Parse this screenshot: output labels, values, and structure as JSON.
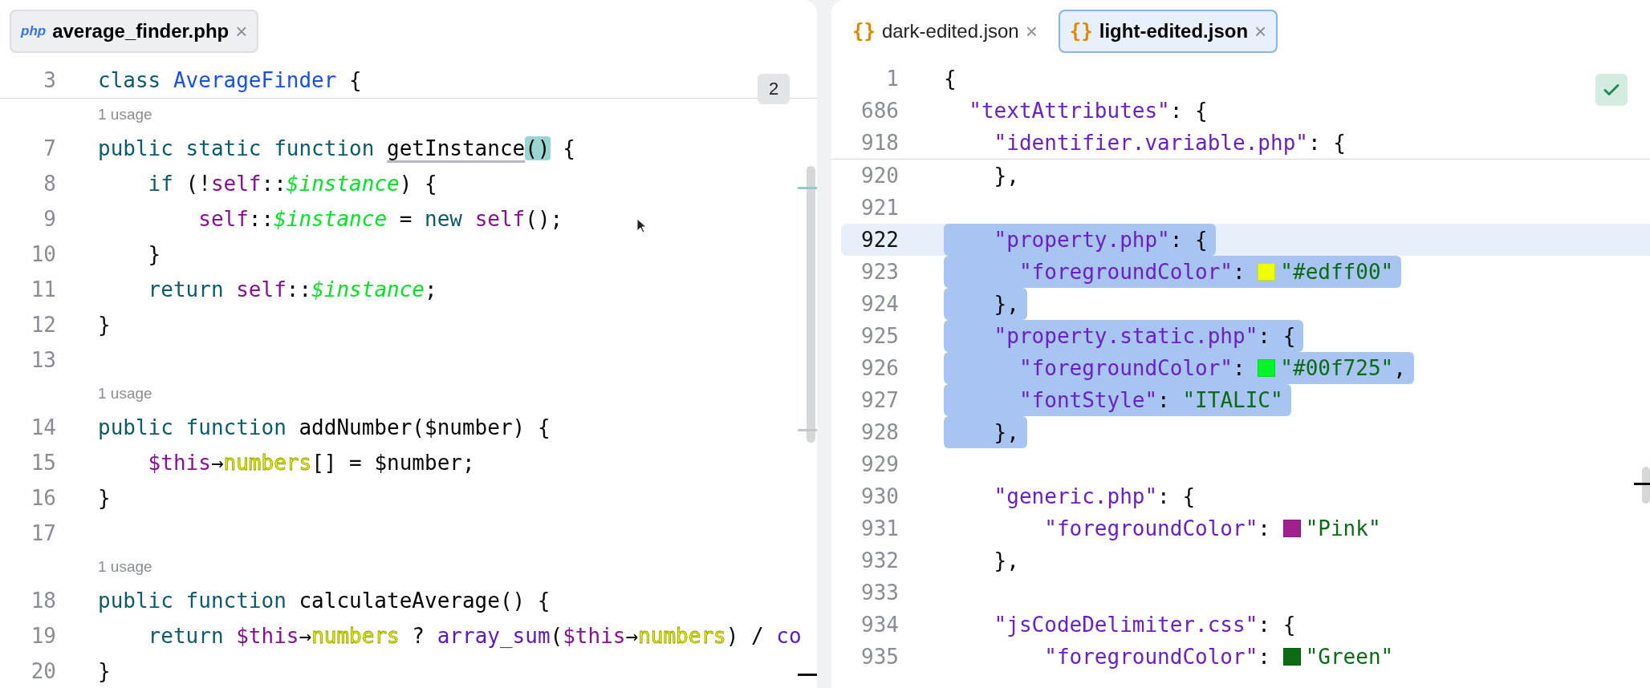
{
  "editors": [
    {
      "focused": false,
      "tabs": [
        {
          "icon": "php",
          "label": "average_finder.php",
          "close": "×",
          "selected": true
        }
      ],
      "badge": "2",
      "sticky": [
        {
          "number": "3",
          "tokens": [
            {
              "t": "class ",
              "kind": "kw"
            },
            {
              "t": "AverageFinder",
              "kind": "cls"
            },
            {
              "t": " {",
              "kind": "plain"
            }
          ]
        }
      ],
      "rows": [
        {
          "kind": "hint",
          "text": "1 usage"
        },
        {
          "kind": "code",
          "number": "7",
          "tokens": [
            {
              "t": "public static function ",
              "kind": "kw"
            },
            {
              "t": "getInstance",
              "kind": "usage"
            },
            {
              "t": "()",
              "kind": "match"
            },
            {
              "t": " {",
              "kind": "plain"
            }
          ]
        },
        {
          "kind": "code",
          "number": "8",
          "tokens": [
            {
              "t": "    if ",
              "kind": "kw"
            },
            {
              "t": "(!",
              "kind": "plain"
            },
            {
              "t": "self",
              "kind": "self"
            },
            {
              "t": "::",
              "kind": "plain"
            },
            {
              "t": "$instance",
              "kind": "svar"
            },
            {
              "t": ") {",
              "kind": "plain"
            }
          ]
        },
        {
          "kind": "code",
          "number": "9",
          "tokens": [
            {
              "t": "        self",
              "kind": "self"
            },
            {
              "t": "::",
              "kind": "plain"
            },
            {
              "t": "$instance",
              "kind": "svar"
            },
            {
              "t": " = ",
              "kind": "plain"
            },
            {
              "t": "new ",
              "kind": "kw"
            },
            {
              "t": "self",
              "kind": "self"
            },
            {
              "t": "();",
              "kind": "plain"
            }
          ]
        },
        {
          "kind": "code",
          "number": "10",
          "tokens": [
            {
              "t": "    }",
              "kind": "plain"
            }
          ]
        },
        {
          "kind": "code",
          "number": "11",
          "tokens": [
            {
              "t": "    return ",
              "kind": "kw"
            },
            {
              "t": "self",
              "kind": "self"
            },
            {
              "t": "::",
              "kind": "plain"
            },
            {
              "t": "$instance",
              "kind": "svar"
            },
            {
              "t": ";",
              "kind": "plain"
            }
          ]
        },
        {
          "kind": "code",
          "number": "12",
          "tokens": [
            {
              "t": "}",
              "kind": "plain"
            }
          ]
        },
        {
          "kind": "code",
          "number": "13",
          "tokens": []
        },
        {
          "kind": "hint",
          "text": "1 usage"
        },
        {
          "kind": "code",
          "number": "14",
          "tokens": [
            {
              "t": "public function ",
              "kind": "kw"
            },
            {
              "t": "addNumber",
              "kind": "fn"
            },
            {
              "t": "($number) {",
              "kind": "plain"
            }
          ]
        },
        {
          "kind": "code",
          "number": "15",
          "tokens": [
            {
              "t": "    $this",
              "kind": "self"
            },
            {
              "t": "→",
              "kind": "plain"
            },
            {
              "t": "numbers",
              "kind": "field"
            },
            {
              "t": "[] = $number;",
              "kind": "plain"
            }
          ]
        },
        {
          "kind": "code",
          "number": "16",
          "tokens": [
            {
              "t": "}",
              "kind": "plain"
            }
          ]
        },
        {
          "kind": "code",
          "number": "17",
          "tokens": []
        },
        {
          "kind": "hint",
          "text": "1 usage"
        },
        {
          "kind": "code",
          "number": "18",
          "tokens": [
            {
              "t": "public function ",
              "kind": "kw"
            },
            {
              "t": "calculateAverage",
              "kind": "fn"
            },
            {
              "t": "() {",
              "kind": "plain"
            }
          ]
        },
        {
          "kind": "code",
          "number": "19",
          "tokens": [
            {
              "t": "    return ",
              "kind": "kw"
            },
            {
              "t": "$this",
              "kind": "self"
            },
            {
              "t": "→",
              "kind": "plain"
            },
            {
              "t": "numbers",
              "kind": "field"
            },
            {
              "t": " ? ",
              "kind": "plain"
            },
            {
              "t": "array_sum",
              "kind": "builtin"
            },
            {
              "t": "(",
              "kind": "plain"
            },
            {
              "t": "$this",
              "kind": "self"
            },
            {
              "t": "→",
              "kind": "plain"
            },
            {
              "t": "numbers",
              "kind": "field"
            },
            {
              "t": ") / ",
              "kind": "plain"
            },
            {
              "t": "co",
              "kind": "builtin"
            }
          ]
        },
        {
          "kind": "code",
          "number": "20",
          "tokens": [
            {
              "t": "}",
              "kind": "plain"
            }
          ]
        }
      ]
    },
    {
      "focused": true,
      "tabs": [
        {
          "icon": "{}",
          "label": "dark-edited.json",
          "close": "×",
          "selected": false
        },
        {
          "icon": "{}",
          "label": "light-edited.json",
          "close": "×",
          "selected": true
        }
      ],
      "checks_passed": true,
      "sticky": [
        {
          "number": "1",
          "tokens": [
            {
              "t": "{",
              "kind": "plain"
            }
          ]
        },
        {
          "number": "686",
          "tokens": [
            {
              "t": "  \"textAttributes\"",
              "kind": "key"
            },
            {
              "t": ": {",
              "kind": "plain"
            }
          ]
        },
        {
          "number": "918",
          "tokens": [
            {
              "t": "    \"identifier.variable.php\"",
              "kind": "key"
            },
            {
              "t": ": {",
              "kind": "plain"
            }
          ]
        }
      ],
      "rows": [
        {
          "kind": "code",
          "number": "920",
          "selected": false,
          "current": false,
          "tokens": [
            {
              "t": "    },",
              "kind": "plain"
            }
          ]
        },
        {
          "kind": "code",
          "number": "921",
          "selected": false,
          "current": false,
          "tokens": []
        },
        {
          "kind": "code",
          "number": "922",
          "selected": true,
          "current": true,
          "tokens": [
            {
              "t": "    \"property.php\"",
              "kind": "key"
            },
            {
              "t": ": {",
              "kind": "plain"
            }
          ]
        },
        {
          "kind": "code",
          "number": "923",
          "selected": true,
          "current": false,
          "tokens": [
            {
              "t": "      \"foregroundColor\"",
              "kind": "key"
            },
            {
              "t": ": ",
              "kind": "plain"
            },
            {
              "kind": "swatch",
              "color": "#edff00"
            },
            {
              "t": "\"#edff00\"",
              "kind": "str"
            }
          ]
        },
        {
          "kind": "code",
          "number": "924",
          "selected": true,
          "current": false,
          "tokens": [
            {
              "t": "    },",
              "kind": "plain"
            }
          ]
        },
        {
          "kind": "code",
          "number": "925",
          "selected": true,
          "current": false,
          "tokens": [
            {
              "t": "    \"property.static.php\"",
              "kind": "key"
            },
            {
              "t": ": {",
              "kind": "plain"
            }
          ]
        },
        {
          "kind": "code",
          "number": "926",
          "selected": true,
          "current": false,
          "tokens": [
            {
              "t": "      \"foregroundColor\"",
              "kind": "key"
            },
            {
              "t": ": ",
              "kind": "plain"
            },
            {
              "kind": "swatch",
              "color": "#00f725"
            },
            {
              "t": "\"#00f725\"",
              "kind": "str"
            },
            {
              "t": ",",
              "kind": "plain"
            }
          ]
        },
        {
          "kind": "code",
          "number": "927",
          "selected": true,
          "current": false,
          "tokens": [
            {
              "t": "      \"fontStyle\"",
              "kind": "key"
            },
            {
              "t": ": ",
              "kind": "plain"
            },
            {
              "t": "\"ITALIC\"",
              "kind": "str"
            }
          ]
        },
        {
          "kind": "code",
          "number": "928",
          "selected": true,
          "current": false,
          "tokens": [
            {
              "t": "    },",
              "kind": "plain"
            }
          ]
        },
        {
          "kind": "code",
          "number": "929",
          "selected": false,
          "current": false,
          "tokens": []
        },
        {
          "kind": "code",
          "number": "930",
          "selected": false,
          "current": false,
          "tokens": [
            {
              "t": "    \"generic.php\"",
              "kind": "key"
            },
            {
              "t": ": {",
              "kind": "plain"
            }
          ]
        },
        {
          "kind": "code",
          "number": "931",
          "selected": false,
          "current": false,
          "tokens": [
            {
              "t": "        \"foregroundColor\"",
              "kind": "key"
            },
            {
              "t": ": ",
              "kind": "plain"
            },
            {
              "kind": "swatch",
              "color": "#a0208e"
            },
            {
              "t": "\"Pink\"",
              "kind": "str"
            }
          ]
        },
        {
          "kind": "code",
          "number": "932",
          "selected": false,
          "current": false,
          "tokens": [
            {
              "t": "    },",
              "kind": "plain"
            }
          ]
        },
        {
          "kind": "code",
          "number": "933",
          "selected": false,
          "current": false,
          "tokens": []
        },
        {
          "kind": "code",
          "number": "934",
          "selected": false,
          "current": false,
          "tokens": [
            {
              "t": "    \"jsCodeDelimiter.css\"",
              "kind": "key"
            },
            {
              "t": ": {",
              "kind": "plain"
            }
          ]
        },
        {
          "kind": "code",
          "number": "935",
          "selected": false,
          "current": false,
          "tokens": [
            {
              "t": "        \"foregroundColor\"",
              "kind": "key"
            },
            {
              "t": ": ",
              "kind": "plain"
            },
            {
              "kind": "swatch",
              "color": "#0b6b12"
            },
            {
              "t": "\"Green\"",
              "kind": "str"
            }
          ]
        }
      ]
    }
  ]
}
